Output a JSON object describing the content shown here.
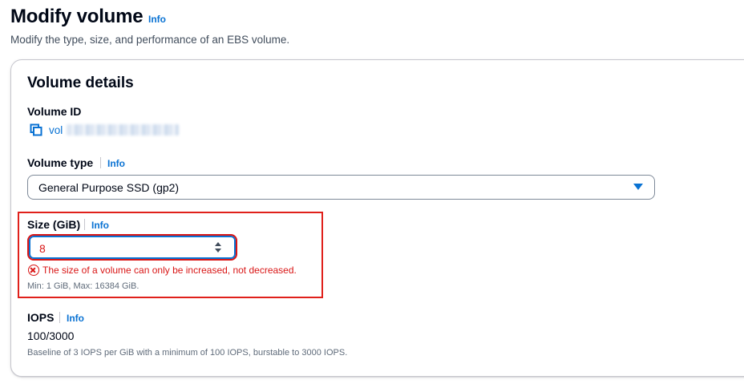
{
  "page": {
    "title": "Modify volume",
    "title_info": "Info",
    "description": "Modify the type, size, and performance of an EBS volume."
  },
  "panel": {
    "title": "Volume details"
  },
  "volume_id": {
    "label": "Volume ID",
    "value_prefix": "vol",
    "icon": "copy-icon"
  },
  "volume_type": {
    "label": "Volume type",
    "info": "Info",
    "selected": "General Purpose SSD (gp2)",
    "icon": "caret-down-icon"
  },
  "size": {
    "label": "Size (GiB)",
    "info": "Info",
    "value": "8",
    "error": "The size of a volume can only be increased, not decreased.",
    "constraint": "Min: 1 GiB, Max: 16384 GiB."
  },
  "iops": {
    "label": "IOPS",
    "info": "Info",
    "value": "100/3000",
    "description": "Baseline of 3 IOPS per GiB with a minimum of 100 IOPS, burstable to 3000 IOPS."
  },
  "colors": {
    "link": "#0972d3",
    "error": "#d91515",
    "highlight": "#e0201b"
  }
}
